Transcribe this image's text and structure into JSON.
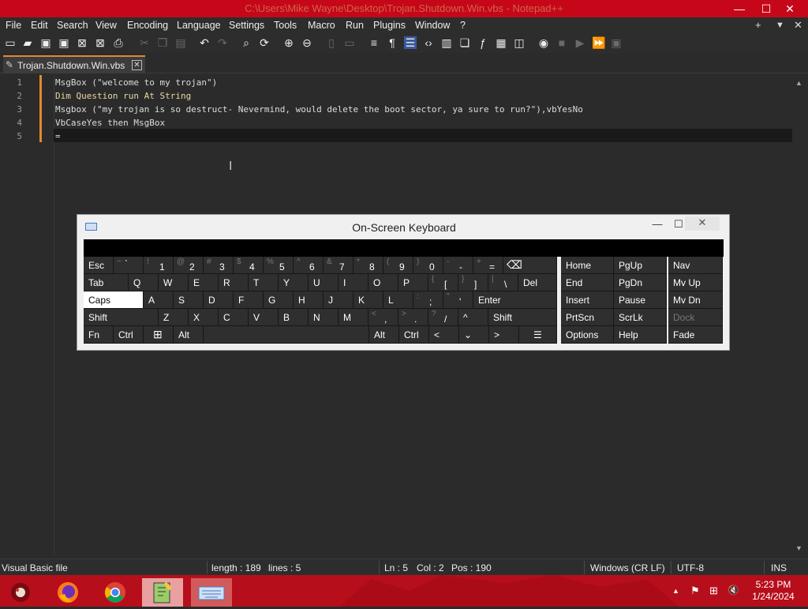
{
  "window": {
    "title": "C:\\Users\\Mike Wayne\\Desktop\\Trojan.Shutdown.Win.vbs - Notepad++",
    "minimize_icon": "minimize-icon",
    "maximize_icon": "maximize-icon",
    "close_icon": "close-icon"
  },
  "menu": [
    "File",
    "Edit",
    "Search",
    "View",
    "Encoding",
    "Language",
    "Settings",
    "Tools",
    "Macro",
    "Run",
    "Plugins",
    "Window",
    "?"
  ],
  "menu_right": {
    "plus": "+",
    "down": "▼",
    "close": "✕"
  },
  "tab": {
    "label": "Trojan.Shutdown.Win.vbs",
    "close": "✕"
  },
  "editor": {
    "line_numbers": [
      "1",
      "2",
      "3",
      "4",
      "5"
    ],
    "lines": [
      "MsgBox (\"welcome to my trojan\")",
      "Dim Question run At String",
      "Msgbox (\"my trojan is so destruct- Nevermind, would delete the boot sector, ya sure to run?\"),vbYesNo",
      "VbCaseYes then MsgBox",
      "="
    ]
  },
  "osk": {
    "title": "On-Screen Keyboard",
    "rows": [
      [
        {
          "m": "Esc"
        },
        {
          "s": "~",
          "m": "`"
        },
        {
          "s": "!",
          "m": "1"
        },
        {
          "s": "@",
          "m": "2"
        },
        {
          "s": "#",
          "m": "3"
        },
        {
          "s": "$",
          "m": "4"
        },
        {
          "s": "%",
          "m": "5"
        },
        {
          "s": "^",
          "m": "6"
        },
        {
          "s": "&",
          "m": "7"
        },
        {
          "s": "*",
          "m": "8"
        },
        {
          "s": "(",
          "m": "9"
        },
        {
          "s": ")",
          "m": "0"
        },
        {
          "s": "-",
          "m": "-"
        },
        {
          "s": "+",
          "m": "="
        },
        {
          "m": "⌫"
        },
        {
          "m": "Home"
        },
        {
          "m": "PgUp"
        },
        {
          "m": "Nav"
        }
      ],
      [
        {
          "m": "Tab"
        },
        {
          "m": "Q"
        },
        {
          "m": "W"
        },
        {
          "m": "E"
        },
        {
          "m": "R"
        },
        {
          "m": "T"
        },
        {
          "m": "Y"
        },
        {
          "m": "U"
        },
        {
          "m": "I"
        },
        {
          "m": "O"
        },
        {
          "m": "P"
        },
        {
          "s": "{",
          "m": "["
        },
        {
          "s": "}",
          "m": "]"
        },
        {
          "s": "|",
          "m": "\\"
        },
        {
          "m": "Del"
        },
        {
          "m": "End"
        },
        {
          "m": "PgDn"
        },
        {
          "m": "Mv Up"
        }
      ],
      [
        {
          "m": "Caps"
        },
        {
          "m": "A"
        },
        {
          "m": "S"
        },
        {
          "m": "D"
        },
        {
          "m": "F"
        },
        {
          "m": "G"
        },
        {
          "m": "H"
        },
        {
          "m": "J"
        },
        {
          "m": "K"
        },
        {
          "m": "L"
        },
        {
          "s": ":",
          "m": ";"
        },
        {
          "s": "\"",
          "m": "'"
        },
        {
          "m": "Enter"
        },
        {
          "m": "Insert"
        },
        {
          "m": "Pause"
        },
        {
          "m": "Mv Dn"
        }
      ],
      [
        {
          "m": "Shift"
        },
        {
          "m": "Z"
        },
        {
          "m": "X"
        },
        {
          "m": "C"
        },
        {
          "m": "V"
        },
        {
          "m": "B"
        },
        {
          "m": "N"
        },
        {
          "m": "M"
        },
        {
          "s": "<",
          "m": ","
        },
        {
          "s": ">",
          "m": "."
        },
        {
          "s": "?",
          "m": "/"
        },
        {
          "m": "^"
        },
        {
          "m": "Shift"
        },
        {
          "m": "PrtScn"
        },
        {
          "m": "ScrLk"
        },
        {
          "m": "Dock"
        }
      ],
      [
        {
          "m": "Fn"
        },
        {
          "m": "Ctrl"
        },
        {
          "m": "⊞"
        },
        {
          "m": "Alt"
        },
        {
          "m": ""
        },
        {
          "m": "Alt"
        },
        {
          "m": "Ctrl"
        },
        {
          "m": "<"
        },
        {
          "m": "⌄"
        },
        {
          "m": ">"
        },
        {
          "m": "☰"
        },
        {
          "m": "Options"
        },
        {
          "m": "Help"
        },
        {
          "m": "Fade"
        }
      ]
    ]
  },
  "status": {
    "filetype": "Visual Basic file",
    "length": "length : 189",
    "lines": "lines : 5",
    "ln": "Ln : 5",
    "col": "Col : 2",
    "pos": "Pos : 190",
    "eol": "Windows (CR LF)",
    "encoding": "UTF-8",
    "ins": "INS"
  },
  "taskbar": {
    "time": "5:23 PM",
    "date": "1/24/2024",
    "apps": [
      "start-icon",
      "firefox-icon",
      "chrome-icon",
      "notepadpp-icon",
      "osk-icon"
    ],
    "tray": {
      "up": "▲",
      "flag": "⚑",
      "net": "⊞",
      "vol": "🔇"
    }
  }
}
